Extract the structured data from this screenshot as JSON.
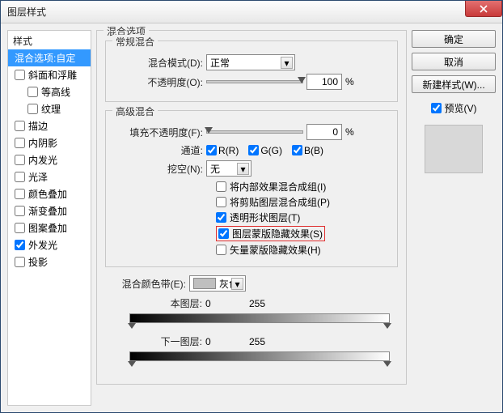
{
  "window": {
    "title": "图层样式"
  },
  "sidebar": {
    "heading": "样式",
    "items": [
      {
        "label": "混合选项:自定",
        "checked": null,
        "selected": true,
        "indent": false
      },
      {
        "label": "斜面和浮雕",
        "checked": false,
        "selected": false,
        "indent": false
      },
      {
        "label": "等高线",
        "checked": false,
        "selected": false,
        "indent": true
      },
      {
        "label": "纹理",
        "checked": false,
        "selected": false,
        "indent": true
      },
      {
        "label": "描边",
        "checked": false,
        "selected": false,
        "indent": false
      },
      {
        "label": "内阴影",
        "checked": false,
        "selected": false,
        "indent": false
      },
      {
        "label": "内发光",
        "checked": false,
        "selected": false,
        "indent": false
      },
      {
        "label": "光泽",
        "checked": false,
        "selected": false,
        "indent": false
      },
      {
        "label": "颜色叠加",
        "checked": false,
        "selected": false,
        "indent": false
      },
      {
        "label": "渐变叠加",
        "checked": false,
        "selected": false,
        "indent": false
      },
      {
        "label": "图案叠加",
        "checked": false,
        "selected": false,
        "indent": false
      },
      {
        "label": "外发光",
        "checked": true,
        "selected": false,
        "indent": false
      },
      {
        "label": "投影",
        "checked": false,
        "selected": false,
        "indent": false
      }
    ]
  },
  "blend_options": {
    "group_title": "混合选项",
    "general": {
      "title": "常规混合",
      "mode_label": "混合模式(D):",
      "mode_value": "正常",
      "opacity_label": "不透明度(O):",
      "opacity_value": "100",
      "opacity_unit": "%"
    },
    "advanced": {
      "title": "高级混合",
      "fill_label": "填充不透明度(F):",
      "fill_value": "0",
      "fill_unit": "%",
      "channels_label": "通道:",
      "channels": {
        "r": "R(R)",
        "g": "G(G)",
        "b": "B(B)"
      },
      "knockout_label": "挖空(N):",
      "knockout_value": "无",
      "checkboxes": [
        {
          "label": "将内部效果混合成组(I)",
          "checked": false,
          "highlight": false
        },
        {
          "label": "将剪贴图层混合成组(P)",
          "checked": false,
          "highlight": false
        },
        {
          "label": "透明形状图层(T)",
          "checked": true,
          "highlight": false
        },
        {
          "label": "图层蒙版隐藏效果(S)",
          "checked": true,
          "highlight": true
        },
        {
          "label": "矢量蒙版隐藏效果(H)",
          "checked": false,
          "highlight": false
        }
      ]
    },
    "blend_if": {
      "title": "混合颜色带(E):",
      "value": "灰色",
      "this_label": "本图层:",
      "this_low": "0",
      "this_high": "255",
      "under_label": "下一图层:",
      "under_low": "0",
      "under_high": "255"
    }
  },
  "right": {
    "ok": "确定",
    "cancel": "取消",
    "new_style": "新建样式(W)...",
    "preview_label": "预览(V)",
    "preview_checked": true
  }
}
